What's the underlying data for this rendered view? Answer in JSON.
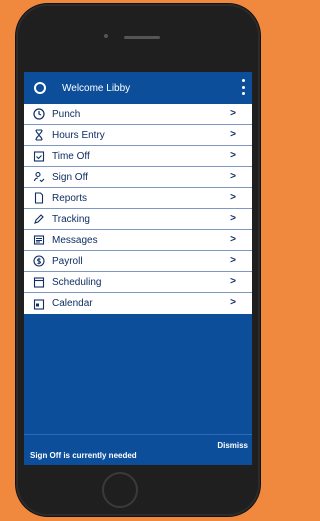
{
  "header": {
    "welcome": "Welcome Libby"
  },
  "menu": {
    "items": [
      {
        "label": "Punch",
        "icon": "clock-icon"
      },
      {
        "label": "Hours Entry",
        "icon": "hourglass-icon"
      },
      {
        "label": "Time Off",
        "icon": "calendar-check-icon"
      },
      {
        "label": "Sign Off",
        "icon": "user-check-icon"
      },
      {
        "label": "Reports",
        "icon": "document-icon"
      },
      {
        "label": "Tracking",
        "icon": "pencil-icon"
      },
      {
        "label": "Messages",
        "icon": "message-icon"
      },
      {
        "label": "Payroll",
        "icon": "dollar-icon"
      },
      {
        "label": "Scheduling",
        "icon": "calendar-icon"
      },
      {
        "label": "Calendar",
        "icon": "calendar-day-icon"
      }
    ]
  },
  "notice": {
    "text": "Sign Off is currently needed",
    "dismiss": "Dismiss"
  },
  "colors": {
    "primary": "#0D4E9B",
    "background": "#F0883E",
    "text": "#0f2e63"
  }
}
